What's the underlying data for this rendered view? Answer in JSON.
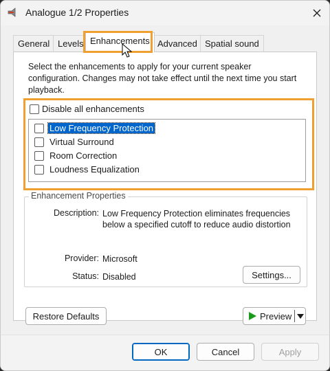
{
  "window": {
    "title": "Analogue 1/2 Properties"
  },
  "tabs": [
    {
      "label": "General"
    },
    {
      "label": "Levels"
    },
    {
      "label": "Enhancements",
      "active": true
    },
    {
      "label": "Advanced"
    },
    {
      "label": "Spatial sound"
    }
  ],
  "enhancements": {
    "instructions": "Select the enhancements to apply for your current speaker configuration. Changes may not take effect until the next time you start playback.",
    "disable_all_label": "Disable all enhancements",
    "disable_all_checked": false,
    "items": [
      {
        "label": "Low Frequency Protection",
        "checked": false,
        "selected": true
      },
      {
        "label": "Virtual Surround",
        "checked": false,
        "selected": false
      },
      {
        "label": "Room Correction",
        "checked": false,
        "selected": false
      },
      {
        "label": "Loudness Equalization",
        "checked": false,
        "selected": false
      }
    ]
  },
  "properties": {
    "group_title": "Enhancement Properties",
    "description_label": "Description:",
    "description_value": "Low Frequency Protection eliminates frequencies below a specified cutoff to reduce audio distortion",
    "provider_label": "Provider:",
    "provider_value": "Microsoft",
    "status_label": "Status:",
    "status_value": "Disabled",
    "settings_button": "Settings..."
  },
  "actions": {
    "restore_defaults": "Restore Defaults",
    "preview": "Preview"
  },
  "footer": {
    "ok": "OK",
    "cancel": "Cancel",
    "apply": "Apply"
  },
  "colors": {
    "highlight_outline": "#f0a030",
    "selection": "#0066cc",
    "play_icon": "#1a9a1a"
  },
  "icons": [
    "speaker-app-icon",
    "close-icon",
    "play-icon",
    "dropdown-arrow-icon",
    "mouse-cursor-icon"
  ]
}
